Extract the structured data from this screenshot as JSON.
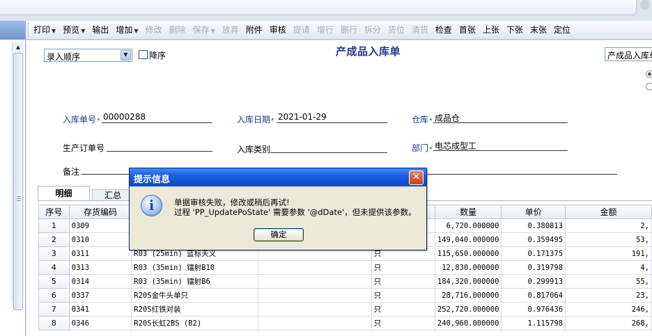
{
  "toolbar": {
    "items": [
      {
        "label": "打印",
        "caret": "▼",
        "disabled": false
      },
      {
        "label": "预览",
        "caret": "▼",
        "disabled": false
      },
      {
        "label": "输出",
        "caret": "",
        "disabled": false
      },
      {
        "label": "增加",
        "caret": "▼",
        "disabled": false
      },
      {
        "label": "修改",
        "caret": "",
        "disabled": true
      },
      {
        "label": "删除",
        "caret": "",
        "disabled": true
      },
      {
        "label": "保存",
        "caret": "▼",
        "disabled": true
      },
      {
        "label": "放弃",
        "caret": "",
        "disabled": true
      },
      {
        "label": "附件",
        "caret": "",
        "disabled": false
      },
      {
        "label": "审核",
        "caret": "",
        "disabled": false
      },
      {
        "label": "提请",
        "caret": "",
        "disabled": true
      },
      {
        "label": "增行",
        "caret": "",
        "disabled": true
      },
      {
        "label": "删行",
        "caret": "",
        "disabled": true
      },
      {
        "label": "拆分",
        "caret": "",
        "disabled": true
      },
      {
        "label": "货位",
        "caret": "",
        "disabled": true
      },
      {
        "label": "清货",
        "caret": "",
        "disabled": true
      },
      {
        "label": "检查",
        "caret": "",
        "disabled": false
      },
      {
        "label": "首张",
        "caret": "",
        "disabled": false
      },
      {
        "label": "上张",
        "caret": "",
        "disabled": false
      },
      {
        "label": "下张",
        "caret": "",
        "disabled": false
      },
      {
        "label": "末张",
        "caret": "",
        "disabled": false
      },
      {
        "label": "定位",
        "caret": "",
        "disabled": false
      }
    ]
  },
  "form": {
    "title": "产成品入库单",
    "order_select": "录入顺序",
    "desc_label": "降序",
    "template_select": "产成品入库单",
    "fields": {
      "receipt_no": {
        "label": "入库单号",
        "value": "00000288"
      },
      "receipt_date": {
        "label": "入库日期",
        "value": "2021-01-29"
      },
      "warehouse": {
        "label": "仓库",
        "value": "成品仓"
      },
      "production_order": {
        "label": "生产订单号",
        "value": ""
      },
      "receipt_type": {
        "label": "入库类别",
        "value": ""
      },
      "department": {
        "label": "部门",
        "value": "电芯成型工"
      },
      "remark": {
        "label": "备注",
        "value": ""
      }
    },
    "required_mark": "*"
  },
  "tabs": [
    "明细",
    "汇总"
  ],
  "grid": {
    "headers": [
      "序号",
      "存货编码",
      "",
      "",
      "",
      "数量",
      "单价",
      "金额"
    ],
    "rows": [
      {
        "idx": "1",
        "code": "0309",
        "name": "",
        "spec": "",
        "unit": "",
        "qty": "6,720.000000",
        "price": "0.380813",
        "amount": "2,"
      },
      {
        "idx": "2",
        "code": "0310",
        "name": "",
        "spec": "",
        "unit": "",
        "qty": "149,040.000000",
        "price": "0.359495",
        "amount": "53,"
      },
      {
        "idx": "3",
        "code": "0311",
        "name": "R03 (25min) 蓝标天义",
        "spec": "",
        "unit": "只",
        "qty": "115,650.000000",
        "price": "0.171375",
        "amount": "191,"
      },
      {
        "idx": "4",
        "code": "0313",
        "name": "R03 (35min) 镭射B10",
        "spec": "",
        "unit": "只",
        "qty": "12,830.000000",
        "price": "0.319798",
        "amount": "4,"
      },
      {
        "idx": "5",
        "code": "0314",
        "name": "R03 (35min) 镭射B6",
        "spec": "",
        "unit": "只",
        "qty": "184,320.000000",
        "price": "0.299913",
        "amount": "55,"
      },
      {
        "idx": "6",
        "code": "0337",
        "name": "R20S金牛头单只",
        "spec": "",
        "unit": "只",
        "qty": "28,716.000000",
        "price": "0.817064",
        "amount": "23,"
      },
      {
        "idx": "7",
        "code": "0341",
        "name": "R20S红铁对装",
        "spec": "",
        "unit": "只",
        "qty": "252,720.000000",
        "price": "0.976436",
        "amount": "246,"
      },
      {
        "idx": "8",
        "code": "0346",
        "name": "R20S长虹2BS (B2)",
        "spec": "",
        "unit": "只",
        "qty": "240,960.000000",
        "price": "1.115798",
        "amount": "268,"
      }
    ]
  },
  "dialog": {
    "title": "提示信息",
    "close": "✕",
    "icon": "i",
    "line1": "单据审核失败，修改或稍后再试!",
    "line2": "过程 'PP_UpdatePoState' 需要参数 '@dDate'，但未提供该参数。",
    "ok_label": "确定"
  }
}
